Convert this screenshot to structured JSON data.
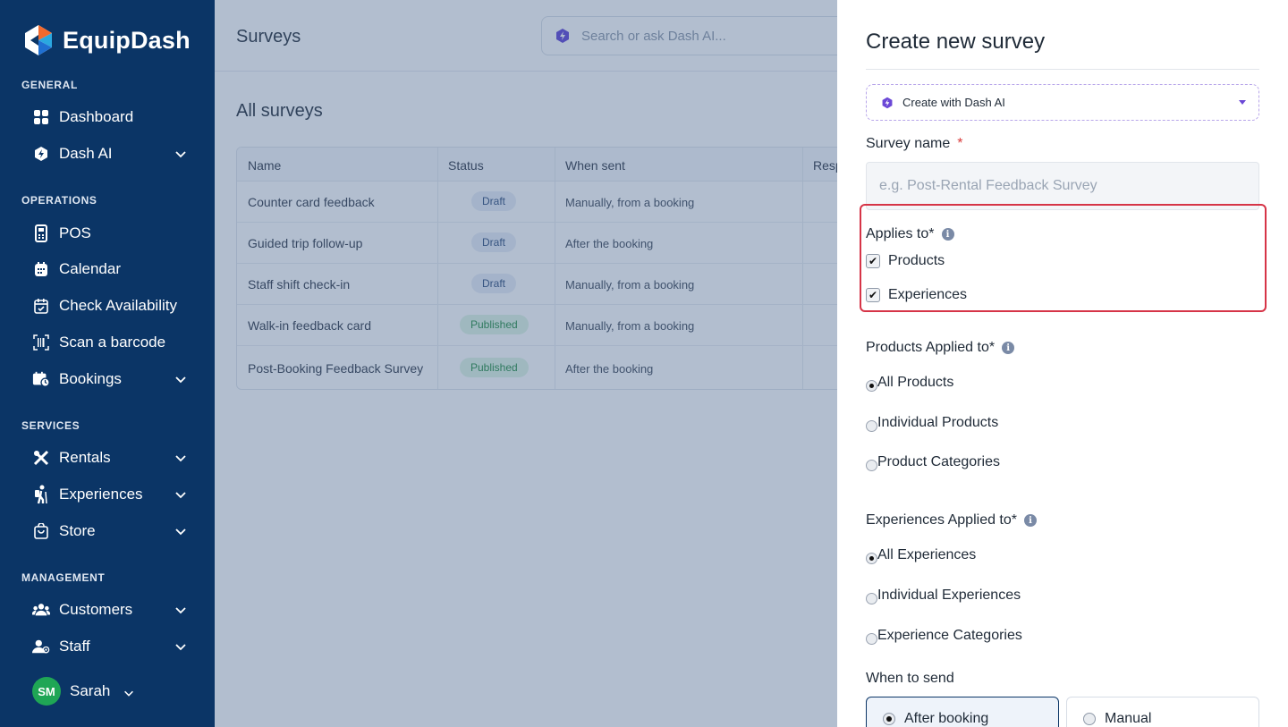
{
  "brand": {
    "name": "EquipDash",
    "sidebar_color": "#0b3566"
  },
  "sidebar": {
    "sections": {
      "general": "GENERAL",
      "operations": "OPERATIONS",
      "services": "SERVICES",
      "management": "MANAGEMENT"
    },
    "items": [
      {
        "label": "Dashboard",
        "icon": "grid-icon"
      },
      {
        "label": "Dash AI",
        "icon": "ai-shield-icon"
      },
      {
        "label": "POS",
        "icon": "pos-terminal-icon"
      },
      {
        "label": "Calendar",
        "icon": "calendar-icon"
      },
      {
        "label": "Check Availability",
        "icon": "calendar-check-icon"
      },
      {
        "label": "Scan a barcode",
        "icon": "barcode-icon"
      },
      {
        "label": "Bookings",
        "icon": "bookings-icon"
      },
      {
        "label": "Rentals",
        "icon": "rentals-icon"
      },
      {
        "label": "Experiences",
        "icon": "hiker-icon"
      },
      {
        "label": "Store",
        "icon": "shopping-bag-icon"
      },
      {
        "label": "Customers",
        "icon": "users-icon"
      },
      {
        "label": "Staff",
        "icon": "staff-icon"
      }
    ],
    "user": {
      "initials": "SM",
      "name": "Sarah"
    }
  },
  "header": {
    "title": "Surveys",
    "search_placeholder": "Search or ask Dash AI..."
  },
  "main": {
    "heading": "All surveys",
    "columns": [
      "Name",
      "Status",
      "When sent",
      "Resp"
    ],
    "rows": [
      {
        "name": "Counter card feedback",
        "status": "Draft",
        "when": "Manually, from a booking"
      },
      {
        "name": "Guided trip follow-up",
        "status": "Draft",
        "when": "After the booking"
      },
      {
        "name": "Staff shift check-in",
        "status": "Draft",
        "when": "Manually, from a booking"
      },
      {
        "name": "Walk-in feedback card",
        "status": "Published",
        "when": "Manually, from a booking"
      },
      {
        "name": "Post-Booking Feedback Survey",
        "status": "Published",
        "when": "After the booking"
      }
    ]
  },
  "drawer": {
    "title": "Create new survey",
    "ai_select": "Create with Dash AI",
    "survey_name_label": "Survey name",
    "survey_name_required": "*",
    "survey_name_placeholder": "e.g. Post-Rental Feedback Survey",
    "applies_to_label": "Applies to*",
    "applies_to": [
      {
        "label": "Products",
        "checked": true
      },
      {
        "label": "Experiences",
        "checked": true
      }
    ],
    "products_applied_label": "Products Applied to*",
    "products_options": [
      {
        "label": "All Products",
        "selected": true
      },
      {
        "label": "Individual Products",
        "selected": false
      },
      {
        "label": "Product Categories",
        "selected": false
      }
    ],
    "experiences_applied_label": "Experiences Applied to*",
    "experiences_options": [
      {
        "label": "All Experiences",
        "selected": true
      },
      {
        "label": "Individual Experiences",
        "selected": false
      },
      {
        "label": "Experience Categories",
        "selected": false
      }
    ],
    "when_to_send_label": "When to send",
    "send_options": [
      {
        "label": "After booking",
        "selected": true
      },
      {
        "label": "Manual",
        "selected": false
      }
    ],
    "highlight_color": "#d63447"
  }
}
